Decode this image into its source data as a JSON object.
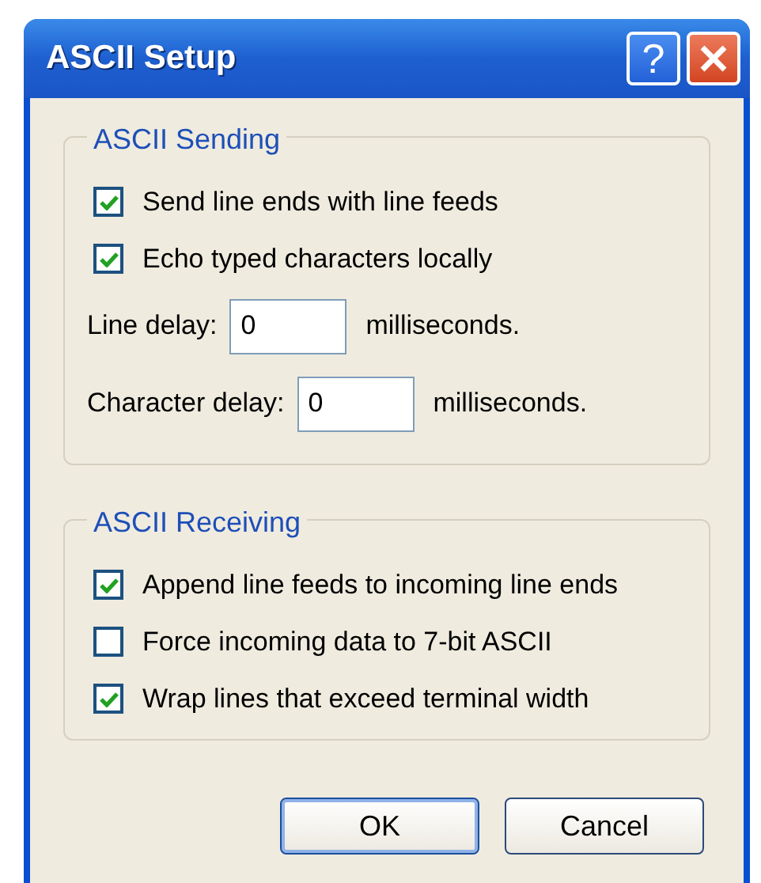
{
  "window": {
    "title": "ASCII Setup",
    "title_buttons": [
      {
        "kind": "help",
        "label": "?"
      },
      {
        "kind": "close"
      }
    ]
  },
  "groups": [
    {
      "title": "ASCII Sending",
      "items": [
        {
          "kind": "checkbox",
          "label": "Send line ends with line feeds",
          "checked": true
        },
        {
          "kind": "checkbox",
          "label": "Echo typed characters locally",
          "checked": true
        },
        {
          "kind": "field",
          "label": "Line delay:",
          "value": "0",
          "unit": "milliseconds."
        },
        {
          "kind": "field",
          "label": "Character delay:",
          "value": "0",
          "unit": "milliseconds."
        }
      ]
    },
    {
      "title": "ASCII Receiving",
      "items": [
        {
          "kind": "checkbox",
          "label": "Append line feeds to incoming line ends",
          "checked": true
        },
        {
          "kind": "checkbox",
          "label": "Force incoming data to 7-bit ASCII",
          "checked": false
        },
        {
          "kind": "checkbox",
          "label": "Wrap lines that exceed terminal width",
          "checked": true
        }
      ]
    }
  ],
  "buttons": [
    {
      "label": "OK",
      "default": true
    },
    {
      "label": "Cancel",
      "default": false
    }
  ]
}
